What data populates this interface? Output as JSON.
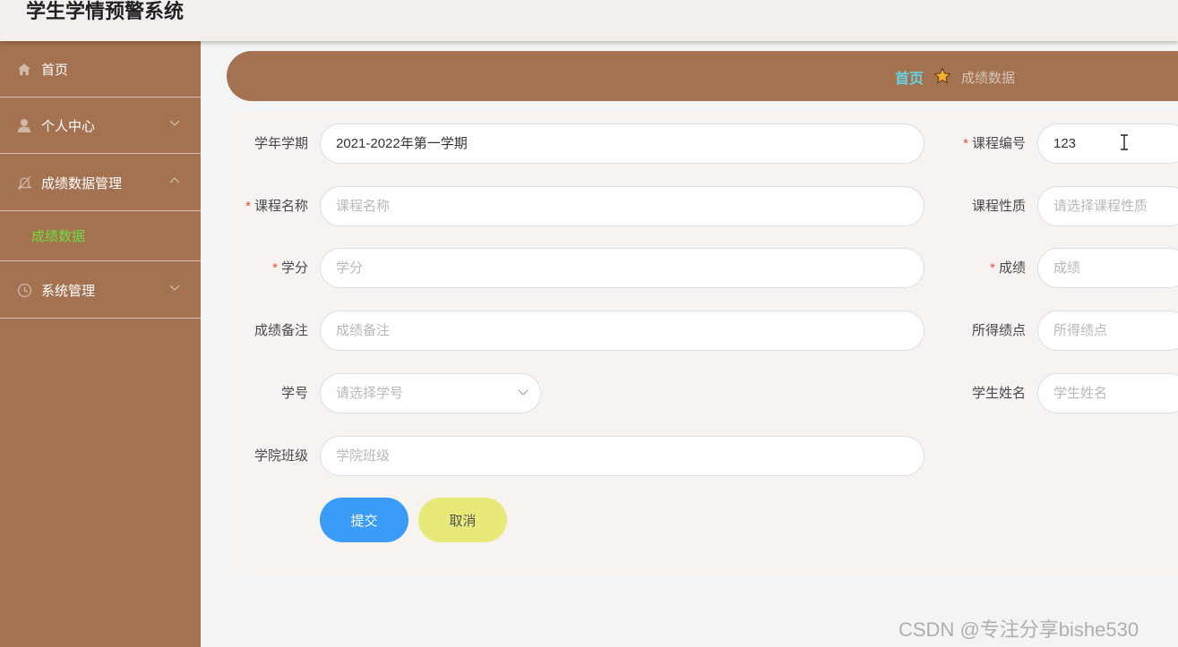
{
  "app": {
    "title": "学生学情预警系统"
  },
  "sidebar": {
    "items": [
      {
        "label": "首页",
        "icon": "home-icon"
      },
      {
        "label": "个人中心",
        "icon": "user-icon"
      },
      {
        "label": "成绩数据管理",
        "icon": "bell-off-icon"
      },
      {
        "label": "系统管理",
        "icon": "clock-icon"
      }
    ],
    "subitems": [
      {
        "label": "成绩数据",
        "active": true
      }
    ],
    "active_color": "#6cdf3f",
    "bg_color": "#a47250"
  },
  "breadcrumb": {
    "home": "首页",
    "current": "成绩数据"
  },
  "form": {
    "term": {
      "label": "学年学期",
      "value": "2021-2022年第一学期"
    },
    "course_code": {
      "label": "课程编号",
      "required": "*",
      "value": "123"
    },
    "course_name": {
      "label": "课程名称",
      "required": "*",
      "placeholder": "课程名称"
    },
    "course_type": {
      "label": "课程性质",
      "placeholder": "请选择课程性质"
    },
    "credit": {
      "label": "学分",
      "required": "*",
      "placeholder": "学分"
    },
    "score": {
      "label": "成绩",
      "required": "*",
      "placeholder": "成绩"
    },
    "score_note": {
      "label": "成绩备注",
      "placeholder": "成绩备注"
    },
    "gpa": {
      "label": "所得绩点",
      "placeholder": "所得绩点"
    },
    "student_no": {
      "label": "学号",
      "placeholder": "请选择学号"
    },
    "student_name": {
      "label": "学生姓名",
      "placeholder": "学生姓名"
    },
    "college_class": {
      "label": "学院班级",
      "placeholder": "学院班级"
    },
    "submit_label": "提交",
    "cancel_label": "取消"
  },
  "watermark": "CSDN @专注分享bishe530"
}
